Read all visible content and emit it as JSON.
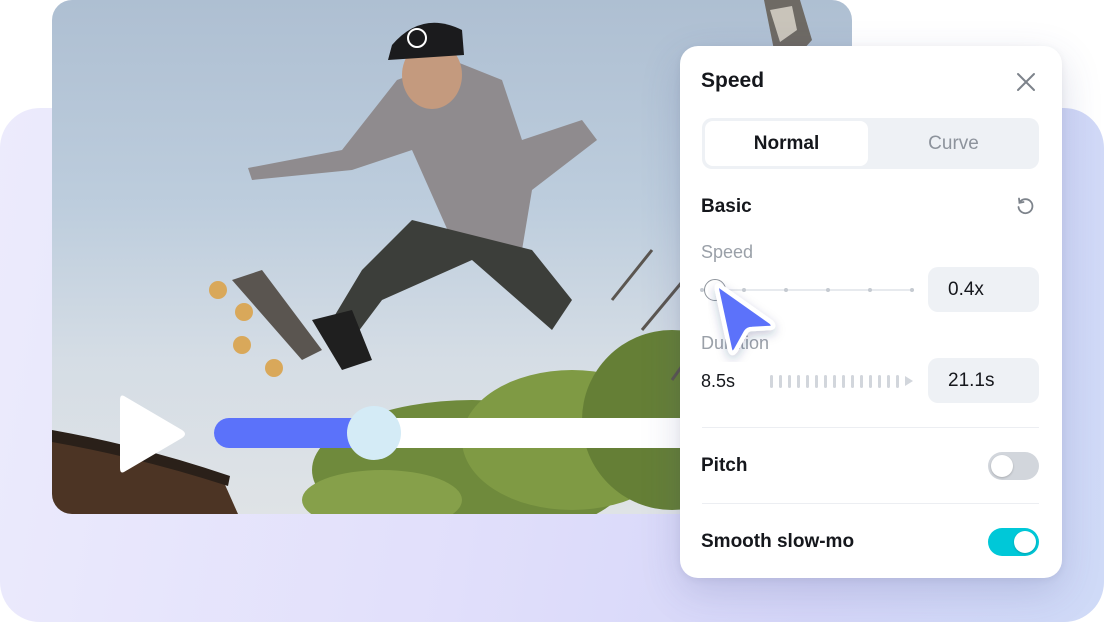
{
  "video": {
    "progress_fraction": 0.25,
    "play_icon": "play-icon"
  },
  "panel": {
    "title": "Speed",
    "close_icon": "close-icon",
    "tabs": [
      {
        "label": "Normal",
        "active": true
      },
      {
        "label": "Curve",
        "active": false
      }
    ],
    "section_label": "Basic",
    "reset_icon": "reset-icon",
    "speed": {
      "label": "Speed",
      "value": "0.4x",
      "slider_fraction": 0.06
    },
    "duration": {
      "label": "Duration",
      "original": "8.5s",
      "value": "21.1s"
    },
    "pitch": {
      "label": "Pitch",
      "enabled": false
    },
    "smooth_slowmo": {
      "label": "Smooth slow-mo",
      "enabled": true
    }
  },
  "colors": {
    "accent": "#5b72fa",
    "toggle_on": "#00c8d8",
    "toggle_off": "#d2d6dc",
    "progress_thumb": "#d4ebf6"
  }
}
